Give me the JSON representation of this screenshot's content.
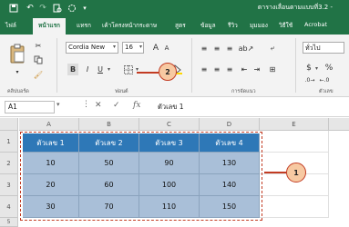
{
  "titlebar": {
    "doc_title": "ตารางเลื่อนตามแบบที่3.2 -"
  },
  "tabs": [
    "ไฟล์",
    "หน้าแรก",
    "แทรก",
    "เค้าโครงหน้ากระดาษ",
    "สูตร",
    "ข้อมูล",
    "รีวิว",
    "มุมมอง",
    "วิธีใช้",
    "Acrobat"
  ],
  "ribbon": {
    "font_name": "Cordia New",
    "font_size": "16",
    "grow_label": "A",
    "shrink_label": "A",
    "bold": "B",
    "italic": "I",
    "underline": "U",
    "number_format": "ทั่วไป",
    "currency": "$",
    "percent": "%",
    "groups": [
      "คลิปบอร์ด",
      "ฟอนต์",
      "การจัดแนว",
      "ตัวเลข"
    ]
  },
  "callouts": [
    "1",
    "2"
  ],
  "formula_bar": {
    "name_box": "A1",
    "fx": "fx",
    "value": "ตัวเลข  1"
  },
  "sheet": {
    "columns": [
      "A",
      "B",
      "C",
      "D",
      "E"
    ],
    "rows": [
      "1",
      "2",
      "3",
      "4",
      "5"
    ],
    "header": [
      "ตัวเลข  1",
      "ตัวเลข  2",
      "ตัวเลข  3",
      "ตัวเลข  4"
    ],
    "data": [
      [
        "10",
        "50",
        "90",
        "130"
      ],
      [
        "20",
        "60",
        "100",
        "140"
      ],
      [
        "30",
        "70",
        "110",
        "150"
      ]
    ]
  },
  "colors": {
    "excel_green": "#217346",
    "header_fill": "#2e78b7",
    "data_fill": "#a9bfd8",
    "callout_stroke": "#c23b22",
    "callout_fill": "#f7c9a2"
  }
}
